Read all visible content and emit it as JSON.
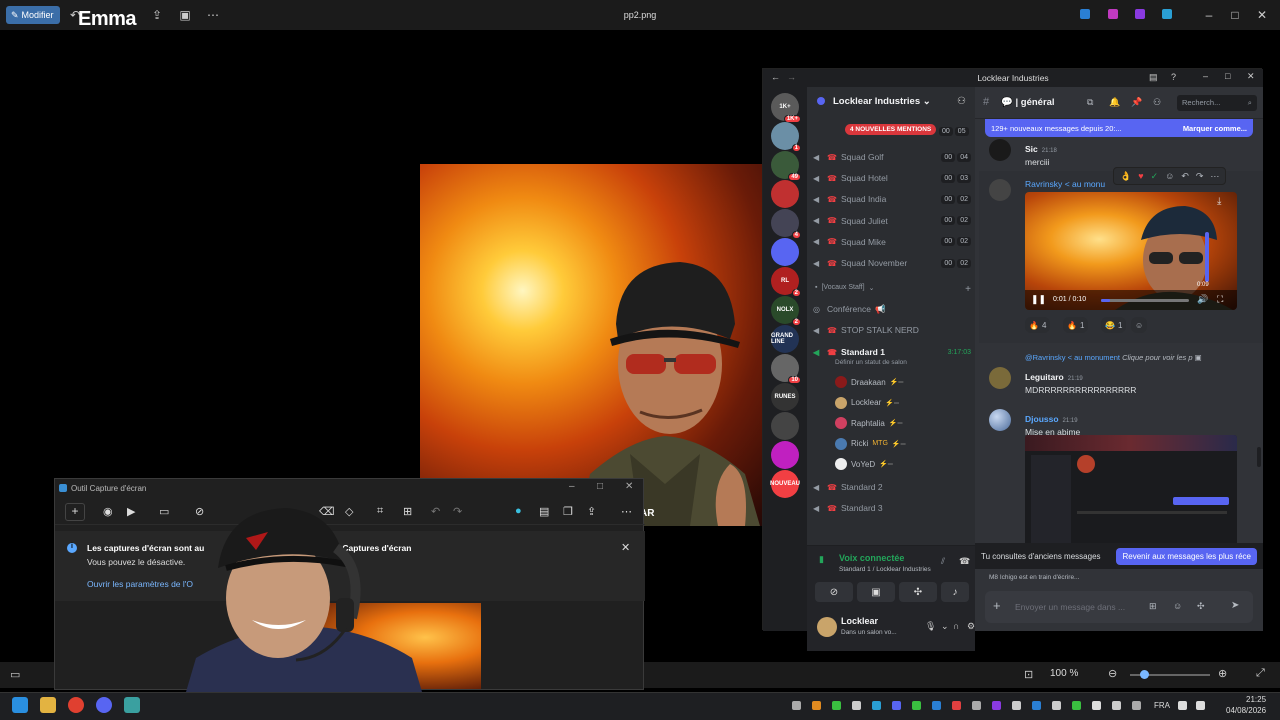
{
  "viewer": {
    "edit_label": "Modifier",
    "brand": "Emma",
    "file_name": "pp2.png",
    "zoom": "100 %",
    "image_caption": "AR"
  },
  "taskbar": {
    "lang": "FRA",
    "time": "21:25",
    "date": "04/08/2026"
  },
  "snip": {
    "title": "Outil Capture d'écran",
    "message_line1": "Les captures d'écran sont au",
    "message_line1b": "ns votre dossier Captures d'écran",
    "message_line2": "Vous pouvez le désactive.",
    "link": "Ouvrir les paramètres de l'O"
  },
  "discord": {
    "window_title": "Locklear Industries",
    "guild_name": "Locklear Industries",
    "mentions_pill": "4 NOUVELLES MENTIONS",
    "servers": [
      {
        "label": "1K+",
        "badge": "1K+",
        "color": "#5a5a5a"
      },
      {
        "label": "",
        "badge": "1",
        "color": "#6b8fa6"
      },
      {
        "label": "",
        "badge": "49",
        "color": "#3a5a3a"
      },
      {
        "label": "",
        "badge": "",
        "color": "#c03030"
      },
      {
        "label": "",
        "badge": "4",
        "color": "#445"
      },
      {
        "label": "",
        "badge": "",
        "color": "#5865f2"
      },
      {
        "label": "RL",
        "badge": "2",
        "color": "#b02020"
      },
      {
        "label": "NOLX",
        "badge": "2",
        "color": "#2a4a2a"
      },
      {
        "label": "GRAND LINE",
        "badge": "",
        "color": "#223355"
      },
      {
        "label": "",
        "badge": "10",
        "color": "#666"
      },
      {
        "label": "RUNES",
        "badge": "",
        "color": "#333"
      },
      {
        "label": "",
        "badge": "",
        "color": "#444"
      },
      {
        "label": "",
        "badge": "",
        "color": "#c020c0"
      },
      {
        "label": "NOUVEAU",
        "badge": "",
        "color": "#f23f43"
      }
    ],
    "channels_top": [
      {
        "name": "Squad Golf",
        "a": "00",
        "b": "04"
      },
      {
        "name": "Squad Hotel",
        "a": "00",
        "b": "03"
      },
      {
        "name": "Squad India",
        "a": "00",
        "b": "02"
      },
      {
        "name": "Squad Juliet",
        "a": "00",
        "b": "02"
      },
      {
        "name": "Squad Mike",
        "a": "00",
        "b": "02"
      },
      {
        "name": "Squad November",
        "a": "00",
        "b": "02"
      }
    ],
    "hidden_count": {
      "a": "00",
      "b": "05"
    },
    "category": "[Vocaux Staff]",
    "conference": "Conférence",
    "stop_stalk": "STOP STALK NERD",
    "standard1": "Standard 1",
    "standard1_time": "3:17:03",
    "standard1_status": "Définir un statut de salon",
    "members": [
      {
        "name": "Draakaan",
        "color": "#8a1a1a"
      },
      {
        "name": "Locklear",
        "color": "#c9a46a"
      },
      {
        "name": "Raphtalia",
        "color": "#d04060"
      },
      {
        "name": "Ricki",
        "tag": "MTG",
        "color": "#4a7ab0"
      },
      {
        "name": "VoYeD",
        "color": "#eee"
      }
    ],
    "standard2": "Standard 2",
    "standard3": "Standard 3",
    "voice_status": "Voix connectée",
    "voice_location": "Standard 1 / Locklear Industries",
    "user_name": "Locklear",
    "user_status": "Dans un salon vo...",
    "channel_name": "général",
    "search_placeholder": "Recherch...",
    "new_messages": "129+ nouveaux messages depuis 20:...",
    "mark_read": "Marquer comme...",
    "messages": {
      "m1_author": "Sic",
      "m1_time": "21:18",
      "m1_text": "merciii",
      "m2_author": "Ravrinsky",
      "m2_suffix": "< au monu",
      "video_time": "0:01 / 0:10",
      "video_remaining": "0:09",
      "reply_author": "@Ravrinsky",
      "reply_suffix": "< au monument",
      "reply_text": "Clique pour voir les p",
      "m3_author": "Leguitaro",
      "m3_time": "21:19",
      "m3_text": "MDRRRRRRRRRRRRRRRR",
      "m4_author": "Djousso",
      "m4_time": "21:19",
      "m4_text": "Mise en abime"
    },
    "reactions": [
      {
        "emoji": "🔥",
        "count": "4"
      },
      {
        "emoji": "🔥",
        "count": "1"
      },
      {
        "emoji": "😂",
        "count": "1"
      }
    ],
    "old_messages": "Tu consultes d'anciens messages",
    "jump_present": "Revenir aux messages les plus réce",
    "typing": "M8 Ichigo est en train d'écrire...",
    "composer_placeholder": "Envoyer un message dans ..."
  }
}
